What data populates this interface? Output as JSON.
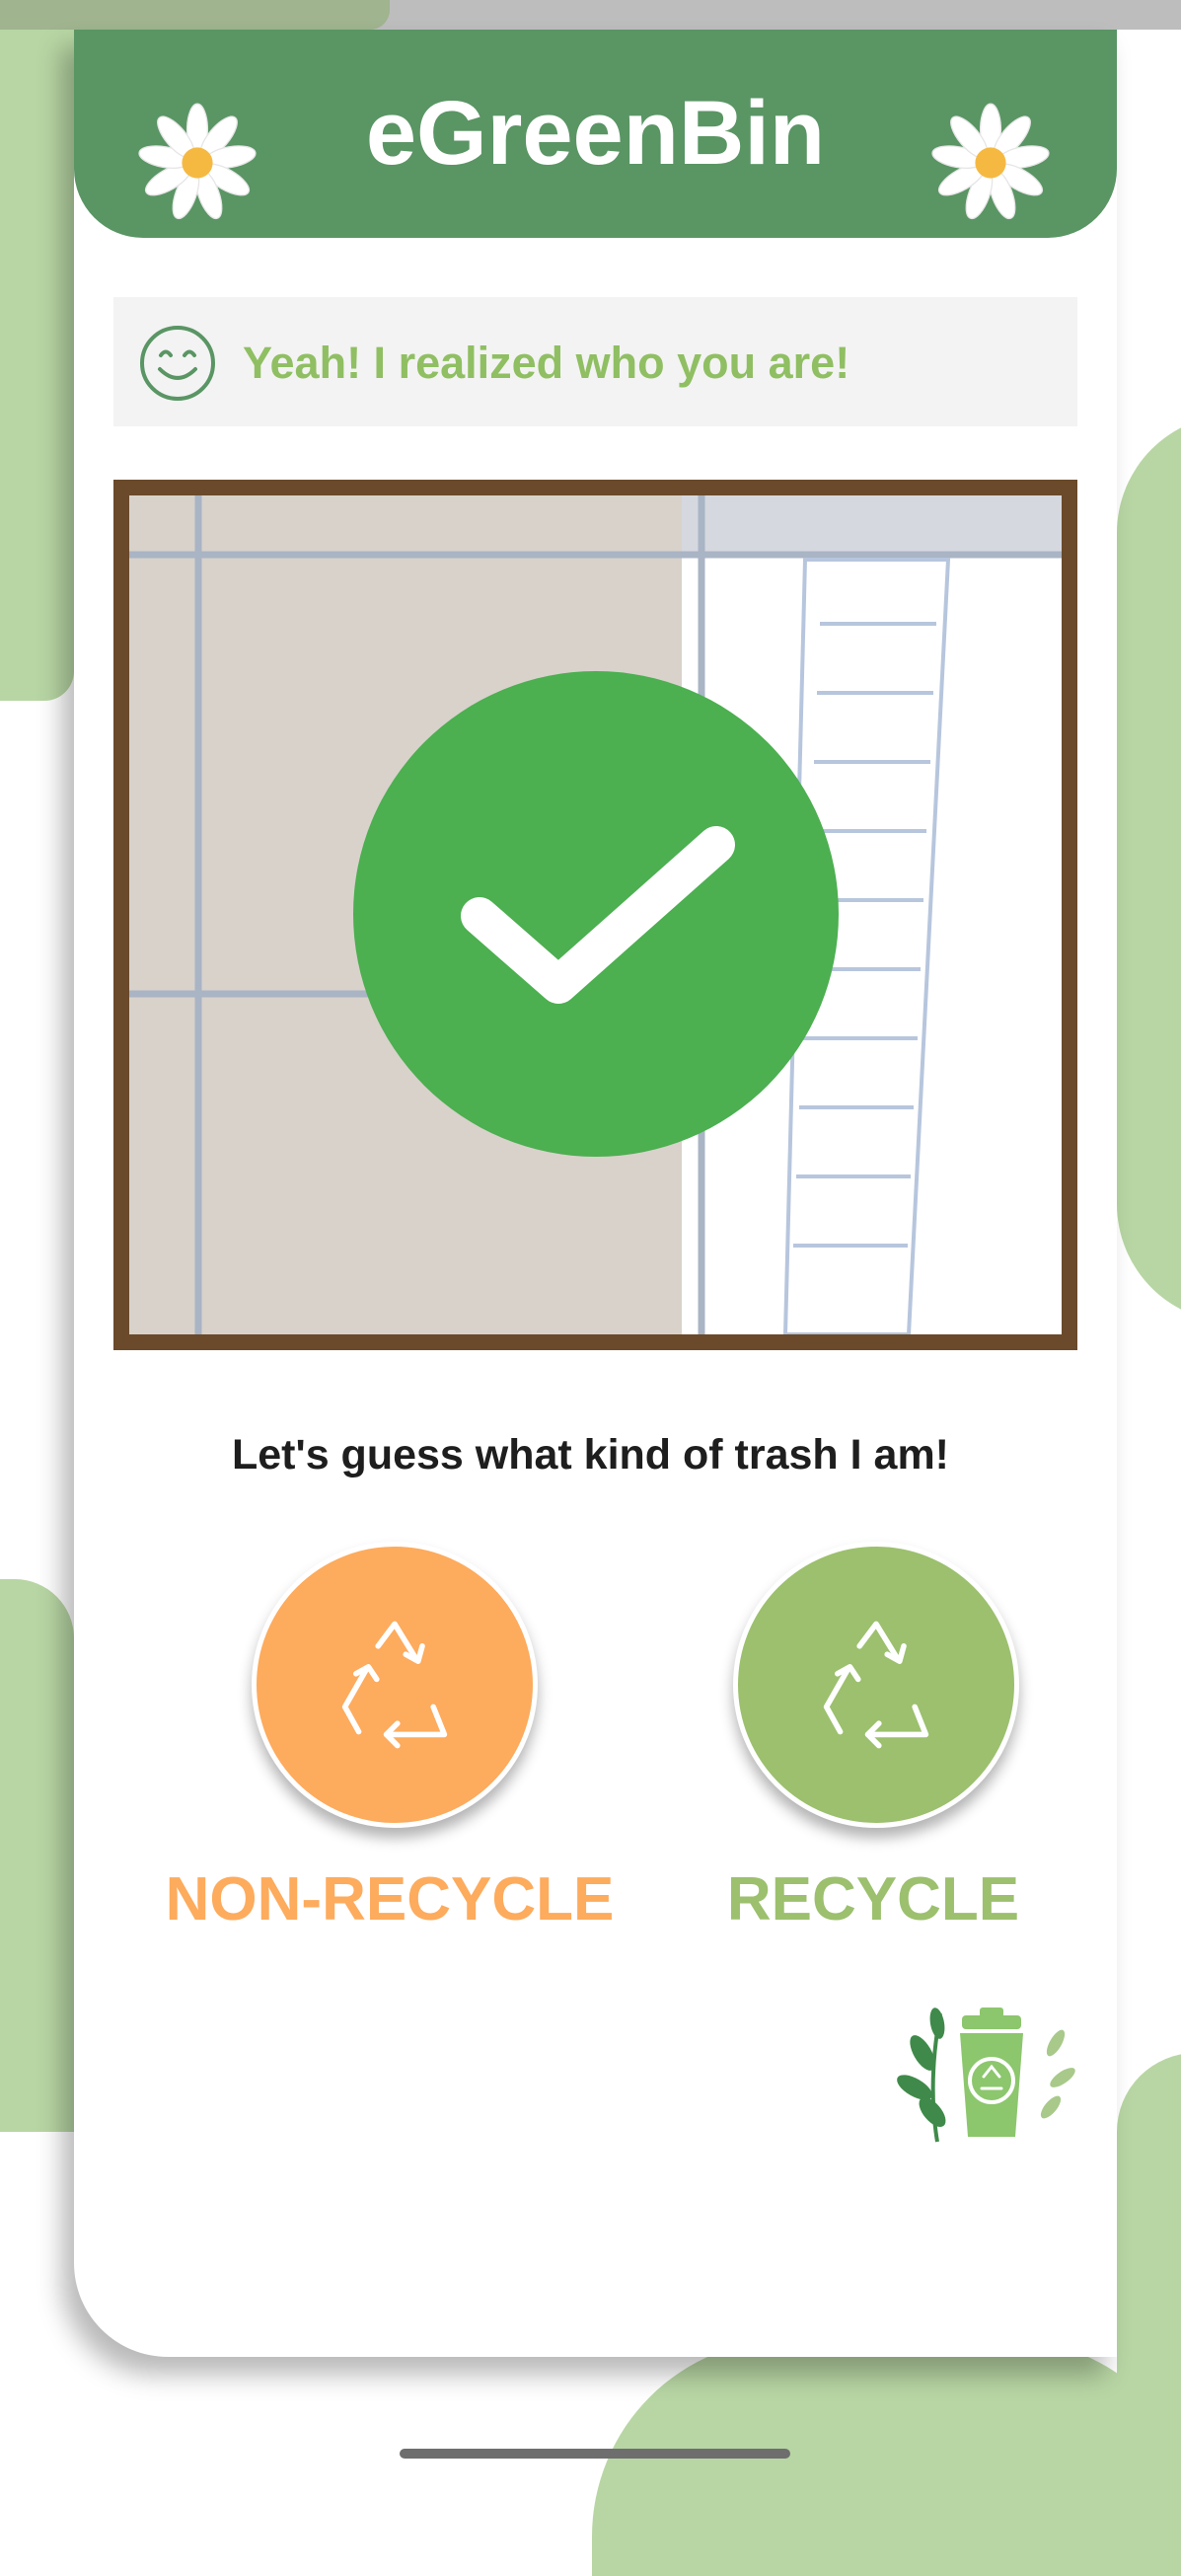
{
  "app": {
    "title": "eGreenBin"
  },
  "status": {
    "message": "Yeah! I realized who you are!",
    "icon": "smiley-icon"
  },
  "camera": {
    "overlay_icon": "checkmark-icon"
  },
  "prompt": {
    "text": "Let's guess what kind of trash I am!"
  },
  "options": {
    "non_recycle": {
      "label": "NON-RECYCLE",
      "icon": "recycle-icon",
      "color": "#fdab5d"
    },
    "recycle": {
      "label": "RECYCLE",
      "icon": "recycle-icon",
      "color": "#9cc06e"
    }
  },
  "colors": {
    "header": "#5a9564",
    "accent_green": "#8fbf62",
    "check": "#4caf50",
    "frame": "#6a4a2b"
  }
}
